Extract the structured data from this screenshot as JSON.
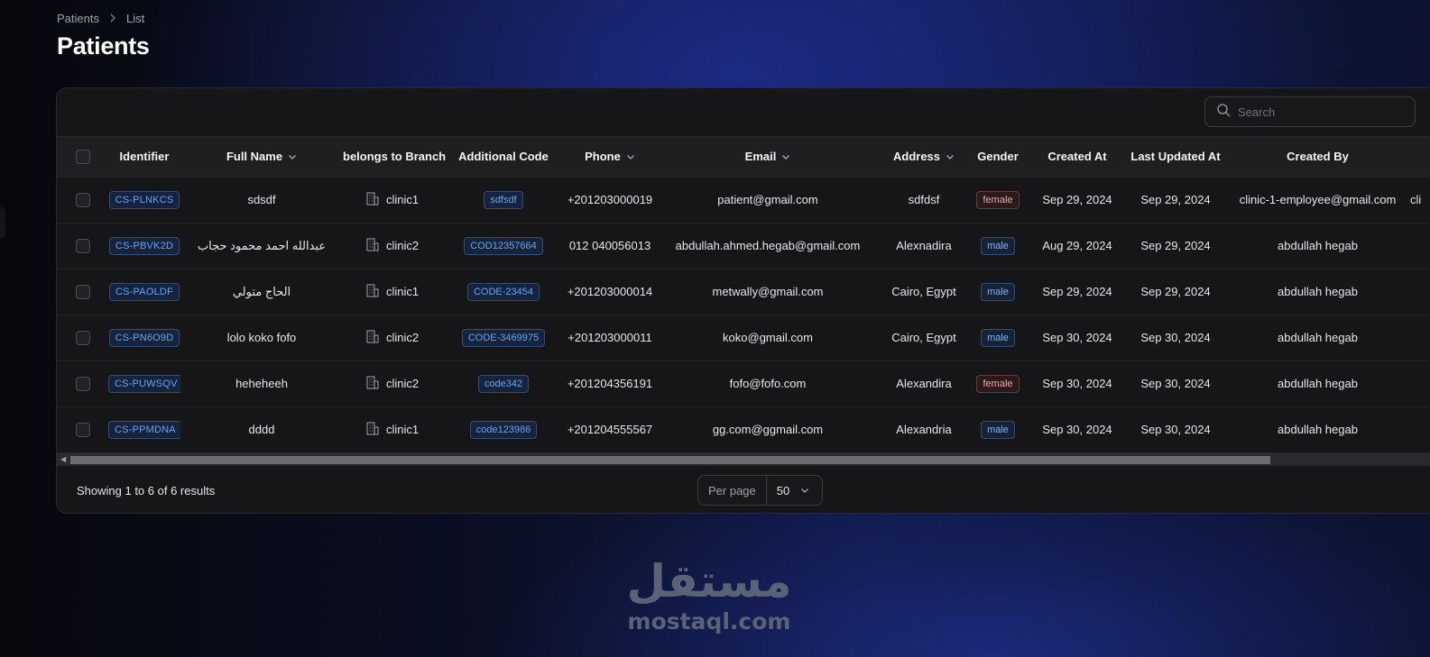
{
  "breadcrumb": {
    "parent": "Patients",
    "current": "List"
  },
  "page": {
    "title": "Patients"
  },
  "search": {
    "placeholder": "Search"
  },
  "columns": {
    "identifier": "Identifier",
    "full_name": "Full Name",
    "branch": "belongs to Branch",
    "additional_code": "Additional Code",
    "phone": "Phone",
    "email": "Email",
    "address": "Address",
    "gender": "Gender",
    "created_at": "Created At",
    "updated_at": "Last Updated At",
    "created_by": "Created By",
    "overflow": "cli"
  },
  "rows": [
    {
      "identifier": "CS-PLNKCS",
      "full_name": "sdsdf",
      "branch": "clinic1",
      "code": "sdfsdf",
      "phone": "+201203000019",
      "email": "patient@gmail.com",
      "address": "sdfdsf",
      "gender": "female",
      "created_at": "Sep 29, 2024",
      "updated_at": "Sep 29, 2024",
      "created_by": "clinic-1-employee@gmail.com",
      "overflow": "cli"
    },
    {
      "identifier": "CS-PBVK2D",
      "full_name": "عبدالله احمد محمود حجاب",
      "branch": "clinic2",
      "code": "COD12357664",
      "phone": "012 040056013",
      "email": "abdullah.ahmed.hegab@gmail.com",
      "address": "Alexnadira",
      "gender": "male",
      "created_at": "Aug 29, 2024",
      "updated_at": "Sep 29, 2024",
      "created_by": "abdullah hegab",
      "overflow": ""
    },
    {
      "identifier": "CS-PAOLDF",
      "full_name": "الحاج متولي",
      "branch": "clinic1",
      "code": "CODE-23454",
      "phone": "+201203000014",
      "email": "metwally@gmail.com",
      "address": "Cairo, Egypt",
      "gender": "male",
      "created_at": "Sep 29, 2024",
      "updated_at": "Sep 29, 2024",
      "created_by": "abdullah hegab",
      "overflow": ""
    },
    {
      "identifier": "CS-PN6O9D",
      "full_name": "lolo koko fofo",
      "branch": "clinic2",
      "code": "CODE-3469975",
      "phone": "+201203000011",
      "email": "koko@gmail.com",
      "address": "Cairo, Egypt",
      "gender": "male",
      "created_at": "Sep 30, 2024",
      "updated_at": "Sep 30, 2024",
      "created_by": "abdullah hegab",
      "overflow": ""
    },
    {
      "identifier": "CS-PUWSQV",
      "full_name": "heheheeh",
      "branch": "clinic2",
      "code": "code342",
      "phone": "+201204356191",
      "email": "fofo@fofo.com",
      "address": "Alexandira",
      "gender": "female",
      "created_at": "Sep 30, 2024",
      "updated_at": "Sep 30, 2024",
      "created_by": "abdullah hegab",
      "overflow": ""
    },
    {
      "identifier": "CS-PPMDNA",
      "full_name": "dddd",
      "branch": "clinic1",
      "code": "code123986",
      "phone": "+201204555567",
      "email": "gg.com@ggmail.com",
      "address": "Alexandria",
      "gender": "male",
      "created_at": "Sep 30, 2024",
      "updated_at": "Sep 30, 2024",
      "created_by": "abdullah hegab",
      "overflow": ""
    }
  ],
  "footer": {
    "results": "Showing 1 to 6 of 6 results",
    "per_page_label": "Per page",
    "per_page_value": "50"
  },
  "watermark": {
    "arabic": "مستقل",
    "latin": "mostaql.com"
  },
  "icons": {
    "breadcrumb_sep": "chevron-right-icon",
    "sort": "chevron-down-icon",
    "search": "search-icon",
    "branch": "building-icon",
    "select": "chevron-down-icon"
  },
  "colors": {
    "accent": "#60a5fa",
    "female": "#f0a6a6",
    "male": "#7cb5ff"
  }
}
